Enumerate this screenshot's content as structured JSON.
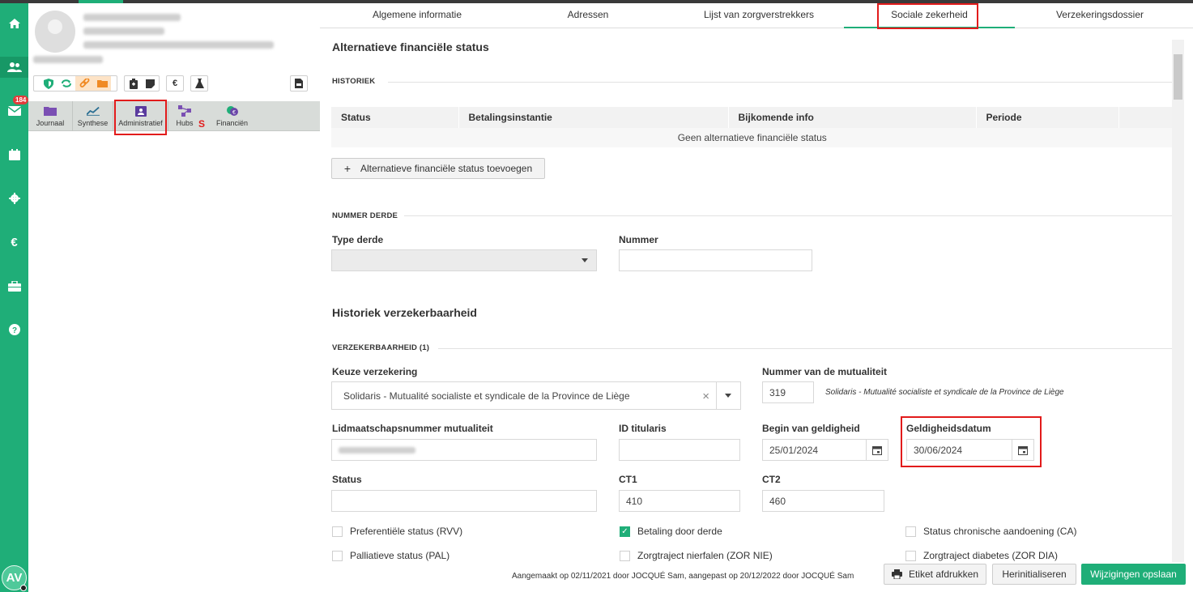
{
  "rail": {
    "messages_badge": "184",
    "avatar_initials": "AV"
  },
  "patient_tabs": [
    {
      "label": "Journaal"
    },
    {
      "label": "Synthese"
    },
    {
      "label": "Administratief"
    },
    {
      "label": "Hubs"
    },
    {
      "label": "Financiën"
    }
  ],
  "hubs_marker": "S",
  "toolbar_icons": {
    "euro": "€"
  },
  "tabs": [
    "Algemene informatie",
    "Adressen",
    "Lijst van zorgverstrekkers",
    "Sociale zekerheid",
    "Verzekeringsdossier"
  ],
  "section_alt": {
    "title": "Alternatieve financiële status",
    "historiek": "HISTORIEK",
    "columns": [
      "Status",
      "Betalingsinstantie",
      "Bijkomende info",
      "Periode"
    ],
    "empty": "Geen alternatieve financiële status",
    "add_button": "Alternatieve financiële status toevoegen",
    "plus": "+"
  },
  "nummer_derde": {
    "title": "NUMMER DERDE",
    "type_label": "Type derde",
    "type_value": "",
    "nummer_label": "Nummer",
    "nummer_value": ""
  },
  "verzekerbaarheid": {
    "title": "Historiek verzekerbaarheid",
    "sub": "VERZEKERBAARHEID (1)",
    "keuze_label": "Keuze verzekering",
    "keuze_value": "Solidaris - Mutualité socialiste et syndicale de la Province de Liège",
    "clear": "×",
    "mut_label": "Nummer van de mutualiteit",
    "mut_value": "319",
    "mut_name": "Solidaris - Mutualité socialiste et syndicale de la Province de Liège",
    "lid_label": "Lidmaatschapsnummer mutualiteit",
    "tit_label": "ID titularis",
    "tit_value": "",
    "begin_label": "Begin van geldigheid",
    "begin_value": "25/01/2024",
    "geld_label": "Geldigheidsdatum",
    "geld_value": "30/06/2024",
    "status_label": "Status",
    "status_value": "",
    "ct1_label": "CT1",
    "ct1_value": "410",
    "ct2_label": "CT2",
    "ct2_value": "460",
    "checkboxes": [
      {
        "label": "Preferentiële status (RVV)",
        "checked": false
      },
      {
        "label": "Betaling door derde",
        "checked": true
      },
      {
        "label": "Status chronische aandoening (CA)",
        "checked": false
      },
      {
        "label": "Palliatieve status (PAL)",
        "checked": false
      },
      {
        "label": "Zorgtraject nierfalen (ZOR NIE)",
        "checked": false
      },
      {
        "label": "Zorgtraject diabetes (ZOR DIA)",
        "checked": false
      }
    ]
  },
  "footer": {
    "meta": "Aangemaakt op 02/11/2021 door JOCQUÉ Sam, aangepast op 20/12/2022 door JOCQUÉ Sam",
    "print": "Etiket afdrukken",
    "reset": "Herinitialiseren",
    "save": "Wijzigingen opslaan"
  },
  "colors": {
    "accent": "#1fae78",
    "highlight": "#e21b1b"
  }
}
